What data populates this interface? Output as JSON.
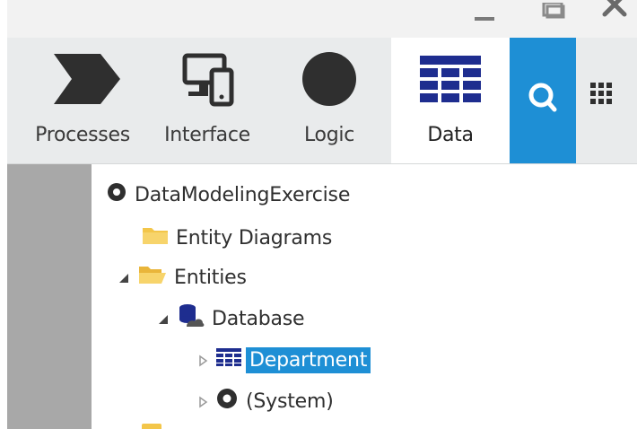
{
  "toolbar": {
    "tabs": [
      {
        "label": "Processes",
        "icon": "processes-chevron-icon"
      },
      {
        "label": "Interface",
        "icon": "devices-icon"
      },
      {
        "label": "Logic",
        "icon": "logic-circle-icon"
      },
      {
        "label": "Data",
        "icon": "data-grid-icon",
        "active": true
      }
    ],
    "search_icon": "search-icon",
    "apps_icon": "apps-grid-icon"
  },
  "tree": {
    "root": {
      "label": "DataModelingExercise",
      "icon": "module-icon"
    },
    "entity_diagrams": {
      "label": "Entity Diagrams",
      "icon": "folder-icon"
    },
    "entities": {
      "label": "Entities",
      "icon": "open-folder-icon",
      "expanded": true
    },
    "database": {
      "label": "Database",
      "icon": "database-icon",
      "expanded": true
    },
    "department": {
      "label": "Department",
      "icon": "entity-table-icon",
      "selected": true
    },
    "system": {
      "label": "(System)",
      "icon": "module-icon"
    }
  },
  "colors": {
    "accent": "#1e8fd5",
    "toolbar_bg": "#e9ebec",
    "leftbar_bg": "#a8a8a8",
    "icon_dark": "#2f2f2f",
    "folder": "#f3c64a"
  }
}
